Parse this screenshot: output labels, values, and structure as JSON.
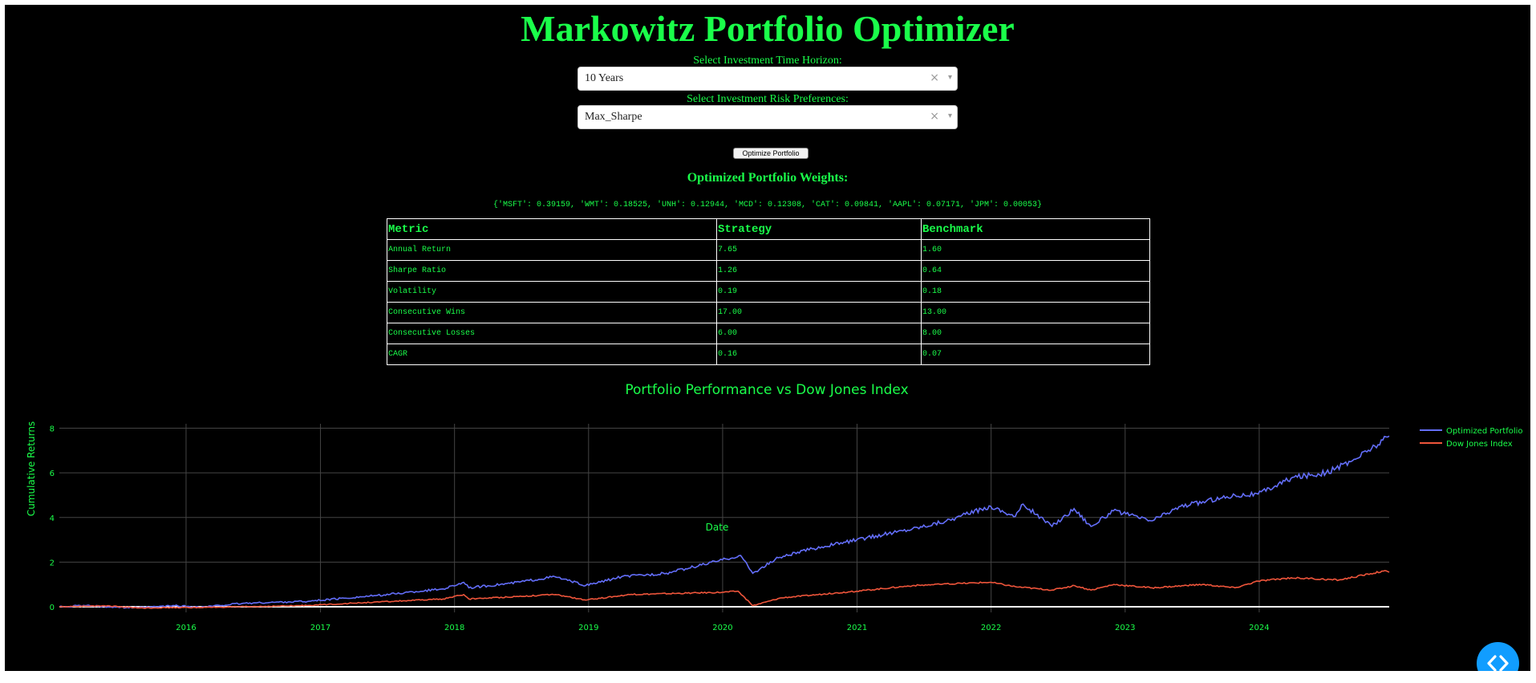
{
  "title": "Markowitz Portfolio Optimizer",
  "controls": {
    "horizon_label": "Select Investment Time Horizon:",
    "horizon_value": "10 Years",
    "risk_label": "Select Investment Risk Preferences:",
    "risk_value": "Max_Sharpe",
    "clear_glyph": "×",
    "caret_glyph": "▾",
    "button_label": "Optimize Portfolio"
  },
  "weights": {
    "heading": "Optimized Portfolio Weights:",
    "text": "{'MSFT': 0.39159, 'WMT': 0.18525, 'UNH': 0.12944, 'MCD': 0.12308, 'CAT': 0.09841, 'AAPL': 0.07171, 'JPM': 0.00053}"
  },
  "metrics_table": {
    "headers": [
      "Metric",
      "Strategy",
      "Benchmark"
    ],
    "rows": [
      [
        "Annual Return",
        "7.65",
        "1.60"
      ],
      [
        "Sharpe Ratio",
        "1.26",
        "0.64"
      ],
      [
        "Volatility",
        "0.19",
        "0.18"
      ],
      [
        "Consecutive Wins",
        "17.00",
        "13.00"
      ],
      [
        "Consecutive Losses",
        "6.00",
        "8.00"
      ],
      [
        "CAGR",
        "0.16",
        "0.07"
      ]
    ]
  },
  "colors": {
    "accent": "#1aff4a",
    "background": "#000000",
    "portfolio": "#636efa",
    "benchmark": "#ef553b",
    "fab": "#119dff"
  },
  "icons": {
    "fab": "code-brackets-icon"
  },
  "chart_data": {
    "type": "line",
    "title": "Portfolio Performance vs Dow Jones Index",
    "xlabel": "Date",
    "ylabel": "Cumulative Returns",
    "x_ticks": [
      "2016",
      "2017",
      "2018",
      "2019",
      "2020",
      "2021",
      "2022",
      "2023",
      "2024"
    ],
    "y_ticks": [
      "0",
      "2",
      "4",
      "6",
      "8"
    ],
    "xlim": [
      "2015-01-21",
      "2024-12-20"
    ],
    "ylim": [
      -0.25,
      8.2
    ],
    "grid": true,
    "legend": "top-right",
    "series": [
      {
        "name": "Optimized Portfolio",
        "points": [
          [
            "2015-01-21",
            0.0
          ],
          [
            "2015-04-01",
            0.05
          ],
          [
            "2015-08-25",
            -0.05
          ],
          [
            "2015-12-01",
            0.05
          ],
          [
            "2016-02-11",
            -0.02
          ],
          [
            "2016-06-01",
            0.15
          ],
          [
            "2016-12-01",
            0.25
          ],
          [
            "2017-06-01",
            0.5
          ],
          [
            "2017-12-01",
            0.8
          ],
          [
            "2018-01-26",
            1.1
          ],
          [
            "2018-02-09",
            0.85
          ],
          [
            "2018-06-01",
            1.05
          ],
          [
            "2018-10-01",
            1.35
          ],
          [
            "2018-12-24",
            0.95
          ],
          [
            "2019-04-01",
            1.35
          ],
          [
            "2019-08-01",
            1.5
          ],
          [
            "2019-12-31",
            2.1
          ],
          [
            "2020-02-19",
            2.3
          ],
          [
            "2020-03-23",
            1.5
          ],
          [
            "2020-06-01",
            2.2
          ],
          [
            "2020-09-01",
            2.6
          ],
          [
            "2020-12-31",
            3.0
          ],
          [
            "2021-06-01",
            3.5
          ],
          [
            "2021-09-01",
            3.85
          ],
          [
            "2021-12-31",
            4.5
          ],
          [
            "2022-03-08",
            4.05
          ],
          [
            "2022-03-29",
            4.6
          ],
          [
            "2022-06-16",
            3.6
          ],
          [
            "2022-08-15",
            4.4
          ],
          [
            "2022-09-30",
            3.6
          ],
          [
            "2022-11-30",
            4.3
          ],
          [
            "2023-03-13",
            3.85
          ],
          [
            "2023-06-01",
            4.5
          ],
          [
            "2023-10-27",
            5.0
          ],
          [
            "2023-12-29",
            5.05
          ],
          [
            "2024-04-01",
            5.8
          ],
          [
            "2024-07-01",
            6.0
          ],
          [
            "2024-09-06",
            6.5
          ],
          [
            "2024-11-11",
            7.2
          ],
          [
            "2024-12-20",
            7.65
          ]
        ]
      },
      {
        "name": "Dow Jones Index",
        "points": [
          [
            "2015-01-21",
            0.0
          ],
          [
            "2015-05-19",
            0.05
          ],
          [
            "2015-08-25",
            -0.05
          ],
          [
            "2016-02-11",
            -0.03
          ],
          [
            "2016-11-08",
            0.05
          ],
          [
            "2017-12-01",
            0.35
          ],
          [
            "2018-01-26",
            0.55
          ],
          [
            "2018-02-09",
            0.35
          ],
          [
            "2018-10-03",
            0.55
          ],
          [
            "2018-12-24",
            0.3
          ],
          [
            "2019-04-23",
            0.55
          ],
          [
            "2019-12-31",
            0.65
          ],
          [
            "2020-02-12",
            0.7
          ],
          [
            "2020-03-23",
            0.05
          ],
          [
            "2020-06-08",
            0.4
          ],
          [
            "2020-12-31",
            0.7
          ],
          [
            "2021-06-01",
            0.95
          ],
          [
            "2021-12-29",
            1.1
          ],
          [
            "2022-03-08",
            0.9
          ],
          [
            "2022-06-16",
            0.75
          ],
          [
            "2022-08-16",
            0.95
          ],
          [
            "2022-09-30",
            0.75
          ],
          [
            "2022-12-01",
            1.0
          ],
          [
            "2023-03-15",
            0.85
          ],
          [
            "2023-07-31",
            1.0
          ],
          [
            "2023-10-27",
            0.85
          ],
          [
            "2023-12-29",
            1.15
          ],
          [
            "2024-03-28",
            1.3
          ],
          [
            "2024-08-05",
            1.2
          ],
          [
            "2024-12-04",
            1.6
          ],
          [
            "2024-12-20",
            1.55
          ]
        ]
      }
    ]
  }
}
